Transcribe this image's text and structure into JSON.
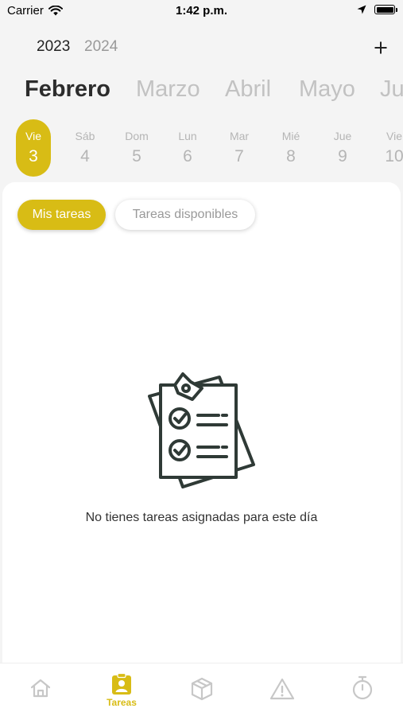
{
  "status_bar": {
    "carrier": "Carrier",
    "time": "1:42 p.m."
  },
  "years": {
    "active": "2023",
    "inactive": "2024"
  },
  "header": {
    "add_icon": "plus-icon"
  },
  "months": [
    "Febrero",
    "Marzo",
    "Abril",
    "Mayo",
    "Ju"
  ],
  "days": [
    {
      "name": "Vie",
      "num": "3",
      "active": true
    },
    {
      "name": "Sáb",
      "num": "4"
    },
    {
      "name": "Dom",
      "num": "5"
    },
    {
      "name": "Lun",
      "num": "6"
    },
    {
      "name": "Mar",
      "num": "7"
    },
    {
      "name": "Mié",
      "num": "8"
    },
    {
      "name": "Jue",
      "num": "9"
    },
    {
      "name": "Vie",
      "num": "10"
    }
  ],
  "tabs": {
    "mine": "Mis tareas",
    "available": "Tareas disponibles"
  },
  "empty_state": {
    "message": "No tienes tareas asignadas para este día",
    "icon": "clipboard-checklist-icon"
  },
  "bottom_nav": {
    "items": [
      {
        "icon": "home-icon"
      },
      {
        "icon": "tasks-icon",
        "label": "Tareas",
        "active": true
      },
      {
        "icon": "box-icon"
      },
      {
        "icon": "warning-icon"
      },
      {
        "icon": "stopwatch-icon"
      }
    ]
  },
  "colors": {
    "accent": "#d8bc15",
    "background": "#f4f4f4"
  }
}
